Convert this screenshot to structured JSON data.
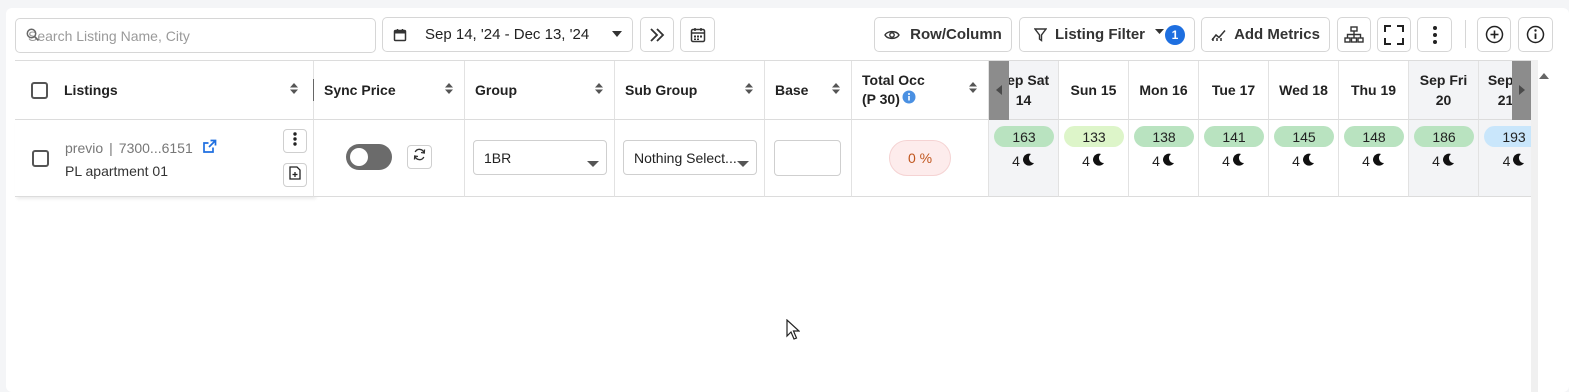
{
  "toolbar": {
    "search_placeholder": "Search Listing Name, City",
    "date_range": "Sep 14, '24 - Dec 13, '24",
    "row_column": "Row/Column",
    "listing_filter": "Listing Filter",
    "filter_count": "1",
    "add_metrics": "Add Metrics"
  },
  "columns": {
    "listings": "Listings",
    "sync_price": "Sync Price",
    "group": "Group",
    "sub_group": "Sub Group",
    "base": "Base",
    "total_occ_line1": "Total Occ",
    "total_occ_line2": "(P 30)"
  },
  "row": {
    "source": "previo",
    "listing_id": "7300...6151",
    "listing_name": "PL apartment 01",
    "group_value": "1BR",
    "sub_group_value": "Nothing Select...",
    "base_value": "",
    "occupancy": "0 %"
  },
  "days": [
    {
      "line1": "Sep Sat",
      "line2": "14",
      "price": "163",
      "nights": "4"
    },
    {
      "line1": "Sun 15",
      "line2": "",
      "price": "133",
      "nights": "4"
    },
    {
      "line1": "Mon 16",
      "line2": "",
      "price": "138",
      "nights": "4"
    },
    {
      "line1": "Tue 17",
      "line2": "",
      "price": "141",
      "nights": "4"
    },
    {
      "line1": "Wed 18",
      "line2": "",
      "price": "145",
      "nights": "4"
    },
    {
      "line1": "Thu 19",
      "line2": "",
      "price": "148",
      "nights": "4"
    },
    {
      "line1": "Sep Fri",
      "line2": "20",
      "price": "186",
      "nights": "4"
    },
    {
      "line1": "Sep Sat",
      "line2": "21",
      "price": "193",
      "nights": "4"
    }
  ],
  "colors": {
    "price_green": "#b9e3c0",
    "price_light_green": "#ddf5c9",
    "price_blue": "#c9e6fb",
    "accent_blue": "#1e6fe0",
    "occ_bg": "#fdecec",
    "occ_text": "#c0561e"
  }
}
